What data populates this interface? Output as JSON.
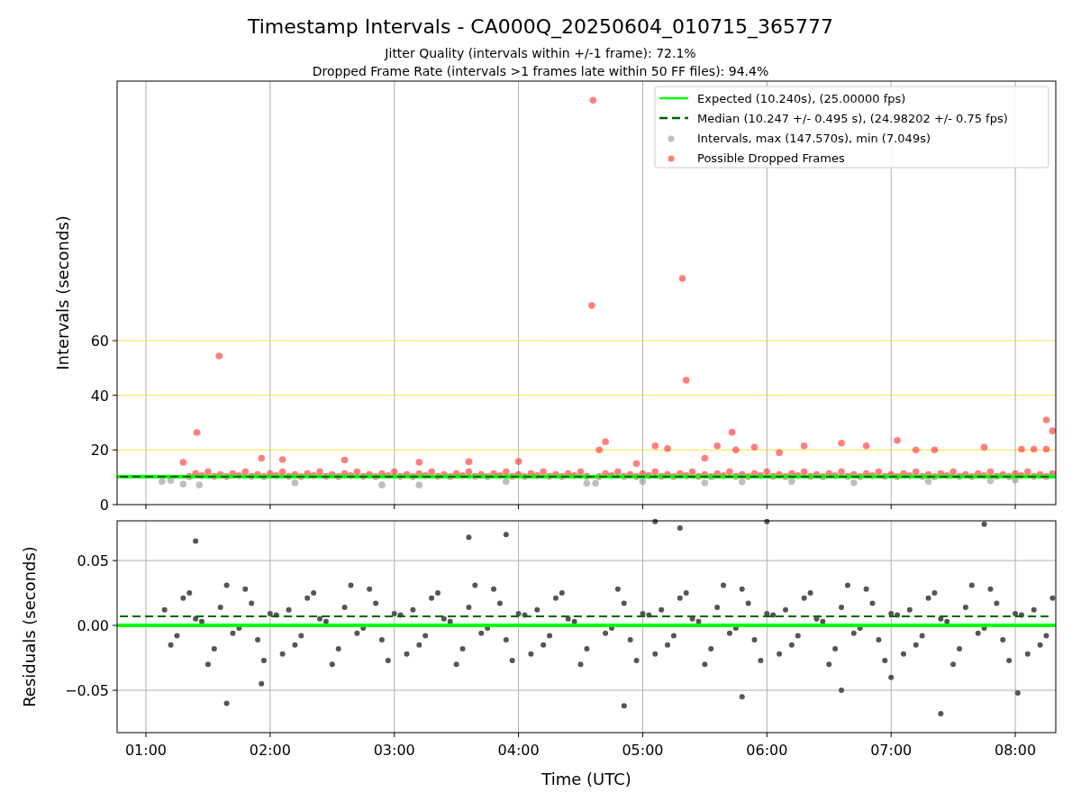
{
  "figure": {
    "title": "Timestamp Intervals - CA000Q_20250604_010715_365777",
    "subtitles": [
      "Jitter Quality (intervals within +/-1 frame): 72.1%",
      "Dropped Frame Rate (intervals >1 frames late within 50 FF files): 94.4%"
    ]
  },
  "main_plot": {
    "chart_data": {
      "type": "scatter",
      "ylabel": "Intervals (seconds)",
      "xlim": [
        0.768,
        8.326
      ],
      "ylim": [
        0,
        155
      ],
      "grid": true,
      "legend": true,
      "yticks": [
        {
          "value": 0,
          "label": "0"
        },
        {
          "value": 20,
          "label": "20"
        },
        {
          "value": 40,
          "label": "40"
        },
        {
          "value": 60,
          "label": "60"
        }
      ],
      "ref_lines": [
        {
          "axis": "y",
          "value": 20,
          "color": "#ffd700"
        },
        {
          "axis": "y",
          "value": 40,
          "color": "#ffd700"
        },
        {
          "axis": "y",
          "value": 60,
          "color": "#ffd700"
        },
        {
          "axis": "y",
          "value": 10.24,
          "label": "Expected (10.240s), (25.00000 fps)",
          "color": "#00ff00"
        },
        {
          "axis": "y",
          "value": 10.247,
          "label": "Median (10.247 +/- 0.495 s), (24.98202 +/- 0.75 fps)",
          "color": "#006400"
        }
      ],
      "series": [
        {
          "name": "Intervals, max (147.570s), min (7.049s)",
          "color": "#808080",
          "x": [
            1.13,
            1.2,
            1.3,
            1.43,
            2.2,
            2.9,
            3.2,
            3.9,
            4.55,
            4.62,
            5.0,
            5.5,
            5.8,
            6.2,
            6.7,
            7.3,
            7.8,
            8.0
          ],
          "values": [
            8.5,
            8.8,
            7.5,
            7.2,
            8,
            7.2,
            7.2,
            8.5,
            7.8,
            7.8,
            8.5,
            8,
            8.3,
            8.5,
            8,
            8.5,
            8.7,
            9
          ]
        },
        {
          "name": "Possible Dropped Frames",
          "color": "#ff0000",
          "x": [
            1.35,
            1.4,
            1.45,
            1.5,
            1.55,
            1.6,
            1.65,
            1.7,
            1.75,
            1.8,
            1.85,
            1.9,
            1.95,
            2,
            2.05,
            2.1,
            2.15,
            2.2,
            2.25,
            2.3,
            2.35,
            2.4,
            2.45,
            2.5,
            2.55,
            2.6,
            2.65,
            2.7,
            2.75,
            2.8,
            2.85,
            2.9,
            2.95,
            3,
            3.05,
            3.1,
            3.15,
            3.2,
            3.25,
            3.3,
            3.35,
            3.4,
            3.45,
            3.5,
            3.55,
            3.6,
            3.65,
            3.7,
            3.75,
            3.8,
            3.85,
            3.9,
            3.95,
            4,
            4.05,
            4.1,
            4.15,
            4.2,
            4.25,
            4.3,
            4.35,
            4.4,
            4.45,
            4.5,
            4.55,
            4.65,
            4.7,
            4.75,
            4.8,
            4.85,
            4.9,
            4.95,
            5,
            5.05,
            5.1,
            5.15,
            5.2,
            5.25,
            5.3,
            5.35,
            5.4,
            5.45,
            5.5,
            5.55,
            5.6,
            5.65,
            5.7,
            5.75,
            5.8,
            5.85,
            5.9,
            5.95,
            6,
            6.05,
            6.1,
            6.15,
            6.2,
            6.25,
            6.3,
            6.35,
            6.4,
            6.45,
            6.5,
            6.55,
            6.6,
            6.65,
            6.7,
            6.75,
            6.8,
            6.85,
            6.9,
            6.95,
            7,
            7.05,
            7.1,
            7.15,
            7.2,
            7.25,
            7.3,
            7.35,
            7.4,
            7.45,
            7.5,
            7.55,
            7.6,
            7.65,
            7.7,
            7.75,
            7.8,
            7.85,
            7.9,
            7.95,
            8,
            8.05,
            8.1,
            8.15,
            8.2,
            8.25,
            8.3,
            1.3,
            1.41,
            1.59,
            1.93,
            2.1,
            2.6,
            3.2,
            3.6,
            4.0,
            4.6,
            4.59,
            4.65,
            4.7,
            4.95,
            5.1,
            5.2,
            5.32,
            5.35,
            5.5,
            5.6,
            5.72,
            5.75,
            5.9,
            6.1,
            6.3,
            6.6,
            6.8,
            7.05,
            7.2,
            7.35,
            7.75,
            8.05,
            8.15,
            8.25,
            8.25,
            8.3
          ],
          "values": [
            10.3,
            11.4,
            10.6,
            12,
            10.4,
            11,
            10.3,
            11.4,
            10.6,
            12,
            10.4,
            11,
            10.3,
            11.4,
            10.6,
            12,
            10.4,
            11,
            10.3,
            11.4,
            10.6,
            12,
            10.4,
            11,
            10.3,
            11.4,
            10.6,
            12,
            10.4,
            11,
            10.3,
            11.4,
            10.6,
            12,
            10.4,
            11,
            10.3,
            11.4,
            10.6,
            12,
            10.4,
            11,
            10.3,
            11.4,
            10.6,
            12,
            10.4,
            11,
            10.3,
            11.4,
            10.6,
            12,
            10.4,
            11,
            10.3,
            11.4,
            10.6,
            12,
            10.4,
            11,
            10.3,
            11.4,
            10.6,
            12,
            10.4,
            10.3,
            11.4,
            10.6,
            12,
            10.4,
            11,
            10.3,
            11.4,
            10.6,
            12,
            10.4,
            11,
            10.3,
            11.4,
            10.6,
            12,
            10.4,
            11,
            10.3,
            11.4,
            10.6,
            12,
            10.4,
            11,
            10.3,
            11.4,
            10.6,
            12,
            10.4,
            11,
            10.3,
            11.4,
            10.6,
            12,
            10.4,
            11,
            10.3,
            11.4,
            10.6,
            12,
            10.4,
            11,
            10.3,
            11.4,
            10.6,
            12,
            10.4,
            11,
            10.3,
            11.4,
            10.6,
            12,
            10.4,
            11,
            10.3,
            11.4,
            10.6,
            12,
            10.4,
            11,
            10.3,
            11.4,
            10.6,
            12,
            10.4,
            11,
            10.3,
            11.4,
            10.6,
            12,
            10.4,
            11,
            10.3,
            11.4,
            15.5,
            26.4,
            54.4,
            17,
            16.5,
            16.3,
            15.5,
            15.7,
            15.8,
            148,
            72.9,
            20,
            23,
            15,
            21.5,
            20.5,
            82.8,
            45.5,
            17,
            21.5,
            26.5,
            20,
            21,
            19,
            21.5,
            22.5,
            21.5,
            23.5,
            20,
            20,
            21,
            20.3,
            20.3,
            20.3,
            31,
            27
          ]
        }
      ]
    }
  },
  "residuals_plot": {
    "chart_data": {
      "type": "scatter",
      "xlabel": "Time (UTC)",
      "ylabel": "Residuals (seconds)",
      "xlim": [
        0.768,
        8.326
      ],
      "ylim": [
        -0.0826,
        0.0806
      ],
      "xticks": [
        {
          "value": 1,
          "label": "01:00"
        },
        {
          "value": 2,
          "label": "02:00"
        },
        {
          "value": 3,
          "label": "03:00"
        },
        {
          "value": 4,
          "label": "04:00"
        },
        {
          "value": 5,
          "label": "05:00"
        },
        {
          "value": 6,
          "label": "06:00"
        },
        {
          "value": 7,
          "label": "07:00"
        },
        {
          "value": 8,
          "label": "08:00"
        }
      ],
      "yticks": [
        {
          "value": -0.05,
          "label": "−0.05"
        },
        {
          "value": 0,
          "label": "0.00"
        },
        {
          "value": 0.05,
          "label": "0.05"
        }
      ],
      "grid": true,
      "ref_lines": [
        {
          "axis": "y",
          "value": 0,
          "color": "#00ff00"
        },
        {
          "axis": "y",
          "value": 0.007,
          "color": "#006400"
        }
      ],
      "series": [
        {
          "color": "#555555",
          "x": [
            1.15,
            1.25,
            1.35,
            1.45,
            1.55,
            1.65,
            1.75,
            1.85,
            1.95,
            2.05,
            2.15,
            2.25,
            2.35,
            2.45,
            2.55,
            2.65,
            2.75,
            2.85,
            2.95,
            3.05,
            3.15,
            3.25,
            3.35,
            3.45,
            3.55,
            3.65,
            3.75,
            3.85,
            3.95,
            4.05,
            4.15,
            4.25,
            4.35,
            4.45,
            4.55,
            4.75,
            4.85,
            4.95,
            5.05,
            5.15,
            5.25,
            5.35,
            5.45,
            5.55,
            5.65,
            5.75,
            5.85,
            5.95,
            6.05,
            6.15,
            6.25,
            6.35,
            6.45,
            6.55,
            6.65,
            6.75,
            6.85,
            6.95,
            7.05,
            7.15,
            7.25,
            7.35,
            7.45,
            7.55,
            7.65,
            7.75,
            7.85,
            7.95,
            8.05,
            8.15,
            8.25,
            1.2,
            1.3,
            1.4,
            1.5,
            1.6,
            1.7,
            1.8,
            1.9,
            2,
            2.1,
            2.2,
            2.3,
            2.4,
            2.5,
            2.6,
            2.7,
            2.8,
            2.9,
            3,
            3.1,
            3.2,
            3.3,
            3.4,
            3.5,
            3.6,
            3.7,
            3.8,
            3.9,
            4,
            4.1,
            4.2,
            4.3,
            4.4,
            4.5,
            4.7,
            4.8,
            4.9,
            5,
            5.1,
            5.2,
            5.3,
            5.4,
            5.5,
            5.6,
            5.7,
            5.8,
            5.9,
            6,
            6.1,
            6.2,
            6.3,
            6.4,
            6.5,
            6.6,
            6.7,
            6.8,
            6.9,
            7,
            7.1,
            7.2,
            7.3,
            7.4,
            7.5,
            7.6,
            7.7,
            7.8,
            7.9,
            8,
            8.1,
            8.2,
            8.3,
            1.4,
            1.65,
            1.93,
            3.6,
            3.9,
            4.85,
            5.1,
            5.3,
            5.8,
            6.0,
            6.6,
            7.0,
            7.4,
            7.75,
            8.02
          ],
          "values": [
            0.012,
            -0.008,
            0.025,
            0.003,
            -0.018,
            0.031,
            -0.002,
            0.017,
            -0.027,
            0.008,
            0.012,
            -0.008,
            0.025,
            0.003,
            -0.018,
            0.031,
            -0.002,
            0.017,
            -0.027,
            0.008,
            0.012,
            -0.008,
            0.025,
            0.003,
            -0.018,
            0.031,
            -0.002,
            0.017,
            -0.027,
            0.008,
            0.012,
            -0.008,
            0.025,
            0.003,
            -0.018,
            -0.002,
            0.017,
            -0.027,
            0.008,
            0.012,
            -0.008,
            0.025,
            0.003,
            -0.018,
            0.031,
            -0.002,
            0.017,
            -0.027,
            0.008,
            0.012,
            -0.008,
            0.025,
            0.003,
            -0.018,
            0.031,
            -0.002,
            0.017,
            -0.027,
            0.008,
            0.012,
            -0.008,
            0.025,
            0.003,
            -0.018,
            0.031,
            -0.002,
            0.017,
            -0.027,
            0.008,
            0.012,
            -0.008,
            -0.015,
            0.021,
            0.005,
            -0.03,
            0.014,
            -0.006,
            0.028,
            -0.011,
            0.009,
            -0.022,
            -0.015,
            0.021,
            0.005,
            -0.03,
            0.014,
            -0.006,
            0.028,
            -0.011,
            0.009,
            -0.022,
            -0.015,
            0.021,
            0.005,
            -0.03,
            0.014,
            -0.006,
            0.028,
            -0.011,
            0.009,
            -0.022,
            -0.015,
            0.021,
            0.005,
            -0.03,
            -0.006,
            0.028,
            -0.011,
            0.009,
            -0.022,
            -0.015,
            0.021,
            0.005,
            -0.03,
            0.014,
            -0.006,
            0.028,
            -0.011,
            0.009,
            -0.022,
            -0.015,
            0.021,
            0.005,
            -0.03,
            0.014,
            -0.006,
            0.028,
            -0.011,
            0.009,
            -0.022,
            -0.015,
            0.021,
            0.005,
            -0.03,
            0.014,
            -0.006,
            0.028,
            -0.011,
            0.009,
            -0.022,
            -0.015,
            0.021,
            0.065,
            -0.06,
            -0.045,
            0.068,
            0.07,
            -0.062,
            0.08,
            0.075,
            -0.055,
            0.08,
            -0.05,
            -0.04,
            -0.068,
            0.078,
            -0.052
          ]
        }
      ]
    }
  }
}
